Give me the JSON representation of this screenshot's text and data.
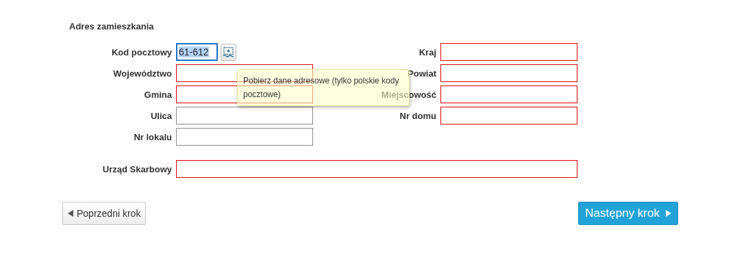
{
  "section_title": "Adres zamieszkania",
  "left_fields": [
    {
      "label": "Kod pocztowy",
      "kind": "postal",
      "value": "61-612",
      "focused": true,
      "invalid": false,
      "highlighted": true
    },
    {
      "label": "Województwo",
      "kind": "text",
      "invalid": true
    },
    {
      "label": "Gmina",
      "kind": "text",
      "invalid": true
    },
    {
      "label": "Ulica",
      "kind": "text",
      "invalid": false
    },
    {
      "label": "Nr lokalu",
      "kind": "text",
      "invalid": false
    }
  ],
  "right_fields": [
    {
      "label": "Kraj",
      "kind": "text",
      "invalid": true
    },
    {
      "label": "Powiat",
      "kind": "text",
      "invalid": true
    },
    {
      "label": "Miejscowość",
      "kind": "text",
      "invalid": true
    },
    {
      "label": "Nr domu",
      "kind": "text",
      "invalid": true
    }
  ],
  "tax_office": {
    "label": "Urząd Skarbowy",
    "invalid": true
  },
  "tooltip": "Pobierz dane adresowe (tylko polskie kody pocztowe)",
  "prev_button": "Poprzedni krok",
  "next_button": "Następny krok"
}
